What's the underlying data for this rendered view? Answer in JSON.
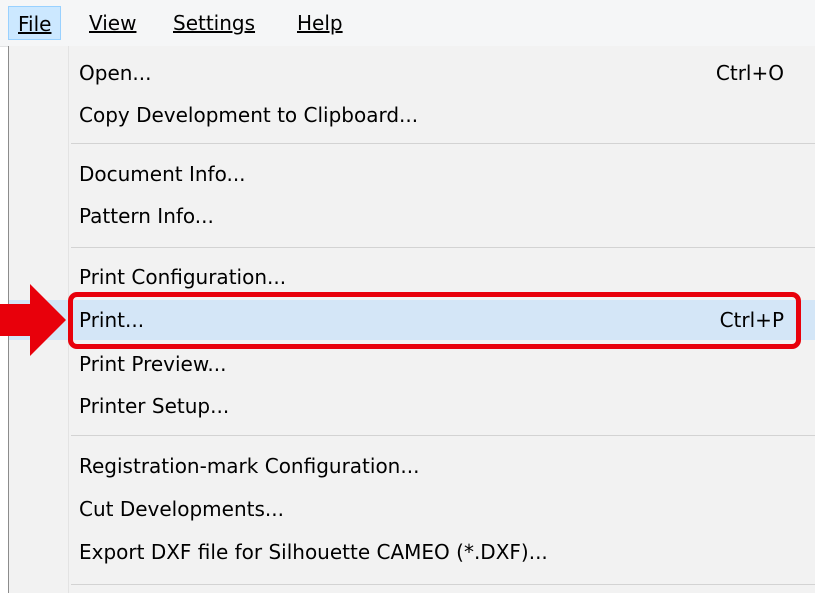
{
  "menubar": {
    "items": [
      {
        "label": "File"
      },
      {
        "label": "View"
      },
      {
        "label": "Settings"
      },
      {
        "label": "Help"
      }
    ]
  },
  "menu": {
    "items": [
      {
        "label": "Open...",
        "shortcut": "Ctrl+O"
      },
      {
        "label": "Copy Development to Clipboard..."
      },
      {
        "label": "Document Info..."
      },
      {
        "label": "Pattern Info..."
      },
      {
        "label": "Print Configuration..."
      },
      {
        "label": "Print...",
        "shortcut": "Ctrl+P",
        "highlighted": true
      },
      {
        "label": "Print Preview..."
      },
      {
        "label": "Printer Setup..."
      },
      {
        "label": "Registration-mark Configuration..."
      },
      {
        "label": "Cut Developments..."
      },
      {
        "label": "Export DXF file for Silhouette CAMEO (*.DXF)..."
      }
    ]
  },
  "annotation": {
    "highlight_color": "#e8000b",
    "pointer": "right-arrow-icon"
  }
}
